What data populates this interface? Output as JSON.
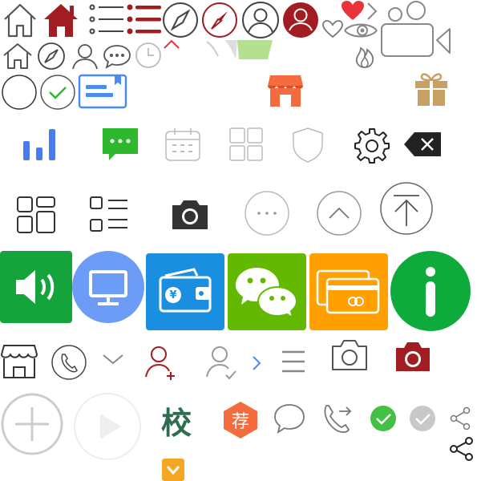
{
  "colors": {
    "outline_dark": "#666666",
    "outline_mid": "#888888",
    "outline_light": "#bbbbbb",
    "dark_red": "#a11d21",
    "heart_red": "#e8333c",
    "blue": "#4a8cf0",
    "light_blue": "#6d9cf7",
    "wechat_green": "#2eb82e",
    "sound_green": "#15a33c",
    "wallet_blue": "#1a8fe0",
    "chat_green": "#62b900",
    "card_orange": "#ffa000",
    "info_green": "#0faa3c",
    "store_orange": "#f46b3d",
    "gift_tan": "#c9a063",
    "school_green": "#2f6d4e",
    "recommend_orange": "#f46b3d",
    "check_green": "#44c043",
    "check_gray": "#c8c8c8",
    "dark": "#222222"
  },
  "icons": [
    "home-outline-icon",
    "home-filled-icon",
    "list-outline-icon",
    "list-filled-icon",
    "compass-outline-icon",
    "compass-filled-icon",
    "user-circle-outline-icon",
    "user-circle-filled-icon",
    "heart-filled-icon",
    "heart-outline-icon",
    "chevron-right-icon",
    "eye-icon",
    "fire-icon",
    "video-camera-icon",
    "home-small-icon",
    "compass-small-icon",
    "user-small-icon",
    "chat-bubble-icon",
    "clock-icon",
    "chevron-up-icon",
    "thumbs-up-icon",
    "empty-circle-icon",
    "check-circle-icon",
    "document-card-icon",
    "store-icon",
    "gift-icon",
    "bar-chart-icon",
    "sms-icon",
    "calendar-icon",
    "grid-icon",
    "shield-icon",
    "gear-icon",
    "backspace-icon",
    "apps-icon",
    "list-grid-icon",
    "camera-filled-icon",
    "more-circle-icon",
    "up-circle-icon",
    "top-circle-icon",
    "sound-icon",
    "monitor-icon",
    "wallet-icon",
    "wechat-icon",
    "card-icon",
    "info-icon",
    "shop-outline-icon",
    "phone-circle-icon",
    "chevron-down-icon",
    "user-add-icon",
    "user-check-icon",
    "chevron-right-small-icon",
    "menu-icon",
    "camera-outline-icon",
    "camera-red-icon",
    "add-circle-icon",
    "play-circle-icon",
    "school-icon",
    "recommend-icon",
    "comment-icon",
    "call-forward-icon",
    "check-green-icon",
    "check-gray-icon",
    "share-outline-icon",
    "share-filled-icon",
    "chevron-down-square-icon"
  ],
  "labels": {
    "yen": "¥",
    "school": "校",
    "recommend": "荐"
  }
}
